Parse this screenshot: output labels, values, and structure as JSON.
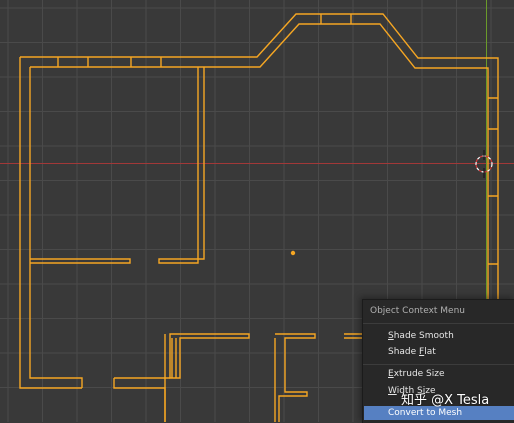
{
  "viewport": {
    "background": "#393939",
    "grid_color": "#4a4a4a",
    "selection_color": "#f5a623",
    "x_axis_color": "#a23838",
    "y_axis_color": "#6a9a2a"
  },
  "context_menu": {
    "title": "Object Context Menu",
    "items": [
      {
        "label": "Shade Smooth",
        "accel": "S",
        "rest": "hade Smooth"
      },
      {
        "label": "Shade Flat",
        "accel": "F",
        "pre": "Shade ",
        "rest": "lat"
      },
      {
        "label": "Extrude Size",
        "accel": "E",
        "rest": "xtrude Size"
      },
      {
        "label": "Width Size",
        "accel": "W",
        "rest": "idth Size"
      },
      {
        "label": "Convert to Mesh",
        "active": true
      }
    ]
  },
  "watermark": "知乎 @X Tesla"
}
